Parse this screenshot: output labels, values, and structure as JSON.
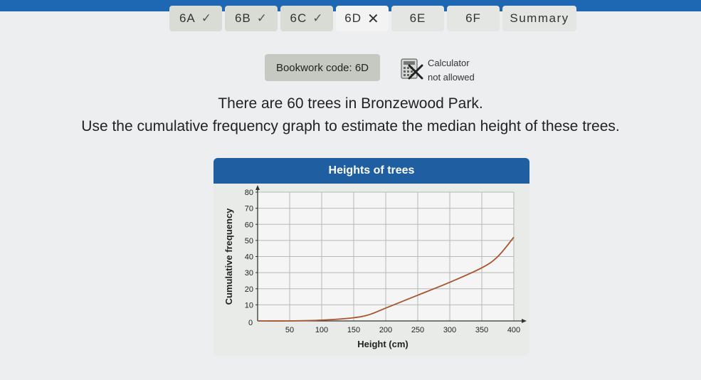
{
  "tabs": [
    {
      "label": "6A",
      "status": "done",
      "status_icon": "check-icon",
      "glyph": "✓"
    },
    {
      "label": "6B",
      "status": "done",
      "status_icon": "check-icon",
      "glyph": "✓"
    },
    {
      "label": "6C",
      "status": "done",
      "status_icon": "check-icon",
      "glyph": "✓"
    },
    {
      "label": "6D",
      "status": "incorrect",
      "status_icon": "cross-icon",
      "glyph": "✕"
    },
    {
      "label": "6E",
      "status": "none"
    },
    {
      "label": "6F",
      "status": "none"
    },
    {
      "label": "Summary",
      "status": "none"
    }
  ],
  "bookwork": {
    "label": "Bookwork code: 6D"
  },
  "calculator": {
    "line1": "Calculator",
    "line2": "not allowed",
    "icon": "calculator-crossed-icon"
  },
  "question": {
    "line1": "There are 60 trees in Bronzewood Park.",
    "line2": "Use the cumulative frequency graph to estimate the median height of these trees."
  },
  "colors": {
    "topbar": "#1d67b3",
    "chart_header": "#1f5ea0",
    "curve": "#a9542f"
  },
  "chart_data": {
    "type": "line",
    "title": "Heights of trees",
    "xlabel": "Height (cm)",
    "ylabel": "Cumulative frequency",
    "xlim": [
      0,
      400
    ],
    "ylim": [
      0,
      80
    ],
    "x_ticks": [
      0,
      50,
      100,
      150,
      200,
      250,
      300,
      350,
      400
    ],
    "y_ticks": [
      0,
      10,
      20,
      30,
      40,
      50,
      60,
      70,
      80
    ],
    "grid": true,
    "series": [
      {
        "x": [
          0,
          50,
          100,
          150,
          175,
          200,
          250,
          300,
          350,
          375,
          400
        ],
        "y": [
          0,
          0,
          0.5,
          2,
          4,
          8,
          16,
          24,
          33,
          40,
          52
        ]
      }
    ]
  }
}
